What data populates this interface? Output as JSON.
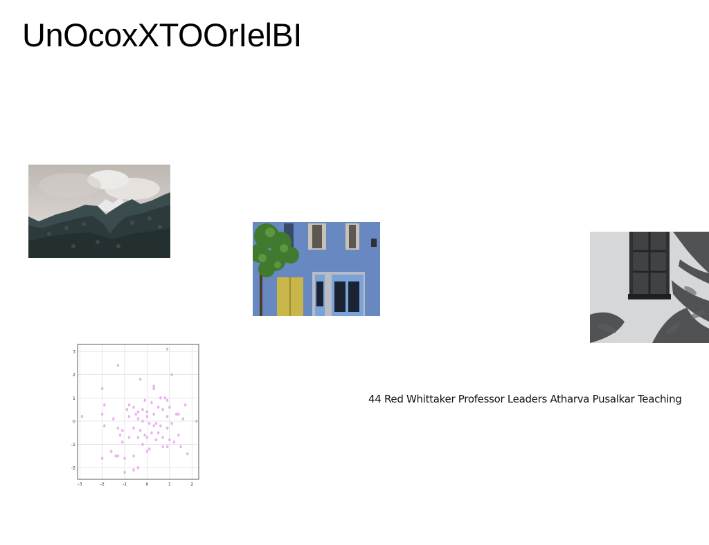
{
  "page": {
    "title": "UnOcoxXTOOrIelBI",
    "caption": "44 Red Whittaker Professor Leaders Atharva Pusalkar Teaching"
  },
  "images": [
    {
      "name": "mountain-photo",
      "subject": "forested mountains under cloudy sky"
    },
    {
      "name": "blue-house-photo",
      "subject": "blue house facade with tree and yellow door"
    },
    {
      "name": "window-shadow-photo",
      "subject": "window on white wall with leaf shadows"
    }
  ],
  "chart_data": {
    "type": "scatter",
    "title": "",
    "xlabel": "",
    "ylabel": "",
    "xlim": [
      -3.1,
      2.3
    ],
    "ylim": [
      -2.5,
      3.3
    ],
    "xticks": [
      "-3",
      "-2",
      "-1",
      "0",
      "1",
      "2"
    ],
    "yticks": [
      "3",
      "2",
      "1",
      "0",
      "-1",
      "-2"
    ],
    "grid": true,
    "color": "#e9a6ec",
    "points": [
      [
        0.9,
        3.1
      ],
      [
        -1.3,
        2.4
      ],
      [
        1.1,
        2.0
      ],
      [
        -0.3,
        1.8
      ],
      [
        -2.0,
        1.4
      ],
      [
        0.3,
        1.5
      ],
      [
        0.3,
        1.4
      ],
      [
        -1.9,
        0.7
      ],
      [
        -0.8,
        0.7
      ],
      [
        -0.6,
        0.6
      ],
      [
        -0.9,
        0.5
      ],
      [
        0.8,
        1.0
      ],
      [
        0.6,
        1.0
      ],
      [
        0.9,
        0.9
      ],
      [
        1.7,
        0.7
      ],
      [
        1.0,
        0.6
      ],
      [
        0.5,
        0.6
      ],
      [
        0.2,
        0.8
      ],
      [
        -0.1,
        0.9
      ],
      [
        -0.2,
        0.5
      ],
      [
        -0.4,
        0.4
      ],
      [
        -0.5,
        0.3
      ],
      [
        -0.4,
        0.1
      ],
      [
        0.0,
        0.4
      ],
      [
        0.0,
        0.2
      ],
      [
        0.3,
        0.3
      ],
      [
        0.7,
        0.5
      ],
      [
        0.9,
        0.2
      ],
      [
        1.4,
        0.3
      ],
      [
        1.6,
        0.1
      ],
      [
        2.2,
        0.0
      ],
      [
        -2.9,
        0.2
      ],
      [
        -2.0,
        0.3
      ],
      [
        -1.5,
        0.1
      ],
      [
        -0.8,
        0.2
      ],
      [
        -0.2,
        0.0
      ],
      [
        0.1,
        -0.1
      ],
      [
        0.4,
        -0.1
      ],
      [
        0.6,
        -0.2
      ],
      [
        1.1,
        -0.1
      ],
      [
        1.3,
        0.3
      ],
      [
        -1.9,
        -0.2
      ],
      [
        -1.3,
        -0.3
      ],
      [
        -1.1,
        -0.4
      ],
      [
        -0.6,
        -0.3
      ],
      [
        -0.3,
        -0.4
      ],
      [
        -0.1,
        -0.6
      ],
      [
        0.2,
        -0.5
      ],
      [
        0.5,
        -0.5
      ],
      [
        0.9,
        -0.3
      ],
      [
        1.4,
        -0.6
      ],
      [
        -1.2,
        -0.6
      ],
      [
        -0.8,
        -0.7
      ],
      [
        -0.4,
        -0.7
      ],
      [
        0.0,
        -0.7
      ],
      [
        0.4,
        -0.8
      ],
      [
        0.7,
        -0.7
      ],
      [
        1.0,
        -0.8
      ],
      [
        1.2,
        -0.9
      ],
      [
        1.5,
        -1.1
      ],
      [
        1.8,
        -1.4
      ],
      [
        -1.1,
        -0.9
      ],
      [
        -0.2,
        -1.0
      ],
      [
        0.0,
        -1.3
      ],
      [
        0.1,
        -1.2
      ],
      [
        0.7,
        -1.1
      ],
      [
        -1.3,
        -1.5
      ],
      [
        -1.0,
        -1.6
      ],
      [
        -0.6,
        -1.5
      ],
      [
        -2.0,
        -1.6
      ],
      [
        -0.4,
        -2.0
      ],
      [
        -0.6,
        -2.1
      ],
      [
        -1.0,
        -2.2
      ],
      [
        -1.6,
        -1.3
      ],
      [
        -1.4,
        -1.5
      ],
      [
        0.9,
        -1.1
      ],
      [
        0.3,
        -0.2
      ]
    ]
  }
}
